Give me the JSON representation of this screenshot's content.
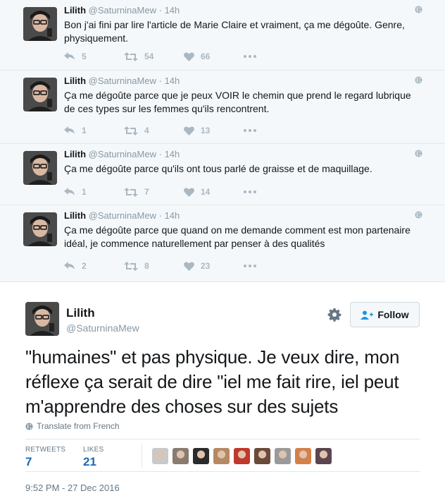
{
  "tweets": [
    {
      "name": "Lilith",
      "handle": "@SaturninaMew",
      "time": "14h",
      "text": "Bon j'ai fini par lire l'article de Marie Claire et vraiment, ça me dégoûte. Genre, physiquement.",
      "replies": "5",
      "retweets": "54",
      "likes": "66"
    },
    {
      "name": "Lilith",
      "handle": "@SaturninaMew",
      "time": "14h",
      "text": "Ça me dégoûte parce que je peux VOIR le chemin que prend le regard lubrique de ces types sur les femmes qu'ils rencontrent.",
      "replies": "1",
      "retweets": "4",
      "likes": "13"
    },
    {
      "name": "Lilith",
      "handle": "@SaturninaMew",
      "time": "14h",
      "text": "Ça me dégoûte parce qu'ils ont tous parlé de graisse et de maquillage.",
      "replies": "1",
      "retweets": "7",
      "likes": "14"
    },
    {
      "name": "Lilith",
      "handle": "@SaturninaMew",
      "time": "14h",
      "text": "Ça me dégoûte parce que quand on me demande comment est mon partenaire idéal, je commence naturellement par penser à des qualités",
      "replies": "2",
      "retweets": "8",
      "likes": "23"
    }
  ],
  "main_tweet": {
    "name": "Lilith",
    "handle": "@SaturninaMew",
    "follow_label": "Follow",
    "text": "\"humaines\" et pas physique. Je veux dire, mon réflexe ça serait de dire \"iel me fait rire, iel peut m'apprendre des choses sur des sujets",
    "translate_label": "Translate from French",
    "retweets_label": "RETWEETS",
    "retweets_count": "7",
    "likes_label": "LIKES",
    "likes_count": "21",
    "timestamp": "9:52 PM - 27 Dec 2016",
    "liker_avatar_colors": [
      "#c9c9c9",
      "#8a7b6f",
      "#2b2b2b",
      "#b58a62",
      "#c0392b",
      "#6b4a3a",
      "#9a9a9a",
      "#d4804a",
      "#5b4550"
    ]
  },
  "colors": {
    "link_blue": "#1b6bb3",
    "muted": "#8899a6",
    "action_gray": "#aab8c2"
  }
}
